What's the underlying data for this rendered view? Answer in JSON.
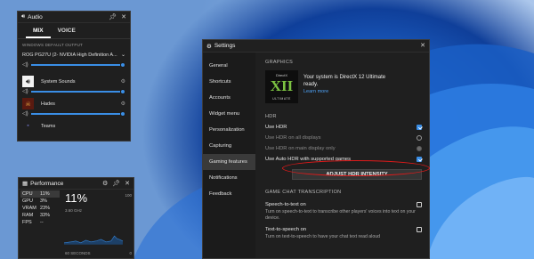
{
  "audio": {
    "title": "Audio",
    "tabs": [
      "MIX",
      "VOICE"
    ],
    "section_label": "WINDOWS DEFAULT OUTPUT",
    "device": "ROG PG27U (2- NVIDIA High Definition A...",
    "device_volume": 0.98,
    "apps": [
      {
        "name": "System Sounds",
        "volume": 0.98
      },
      {
        "name": "Hades",
        "volume": 0.98
      },
      {
        "name": "Teams",
        "volume": 0.98
      }
    ]
  },
  "performance": {
    "title": "Performance",
    "metrics": [
      {
        "label": "CPU",
        "value": "11%"
      },
      {
        "label": "GPU",
        "value": "3%"
      },
      {
        "label": "VRAM",
        "value": "23%"
      },
      {
        "label": "RAM",
        "value": "33%"
      },
      {
        "label": "FPS",
        "value": "--"
      }
    ],
    "big_value": "11%",
    "sub_value": "3.60 GHz",
    "axis_max": "100",
    "axis_min": "0",
    "time_span": "60 SECONDS"
  },
  "settings": {
    "title": "Settings",
    "nav": [
      "General",
      "Shortcuts",
      "Accounts",
      "Widget menu",
      "Personalization",
      "Capturing",
      "Gaming features",
      "Notifications",
      "Feedback"
    ],
    "selected_nav": "Gaming features",
    "graphics_header": "GRAPHICS",
    "dx_logo": {
      "line1": "DirectX",
      "line2": "XII",
      "line3": "ULTIMATE"
    },
    "dx_text": "Your system is DirectX 12 Ultimate ready.",
    "dx_link": "Learn more",
    "hdr_header": "HDR",
    "use_hdr": "Use HDR",
    "hdr_all": "Use HDR on all displays",
    "hdr_main": "Use HDR on main display only",
    "auto_hdr": "Use Auto HDR with supported games",
    "adjust_btn": "ADJUST HDR INTENSITY",
    "transcription_header": "GAME CHAT TRANSCRIPTION",
    "stt_title": "Speech-to-text on",
    "stt_desc": "Turn on speech-to-text to transcribe other players' voices into text on your device.",
    "tts_title": "Text-to-speech on",
    "tts_desc": "Turn on text-to-speech to have your chat text read aloud"
  }
}
